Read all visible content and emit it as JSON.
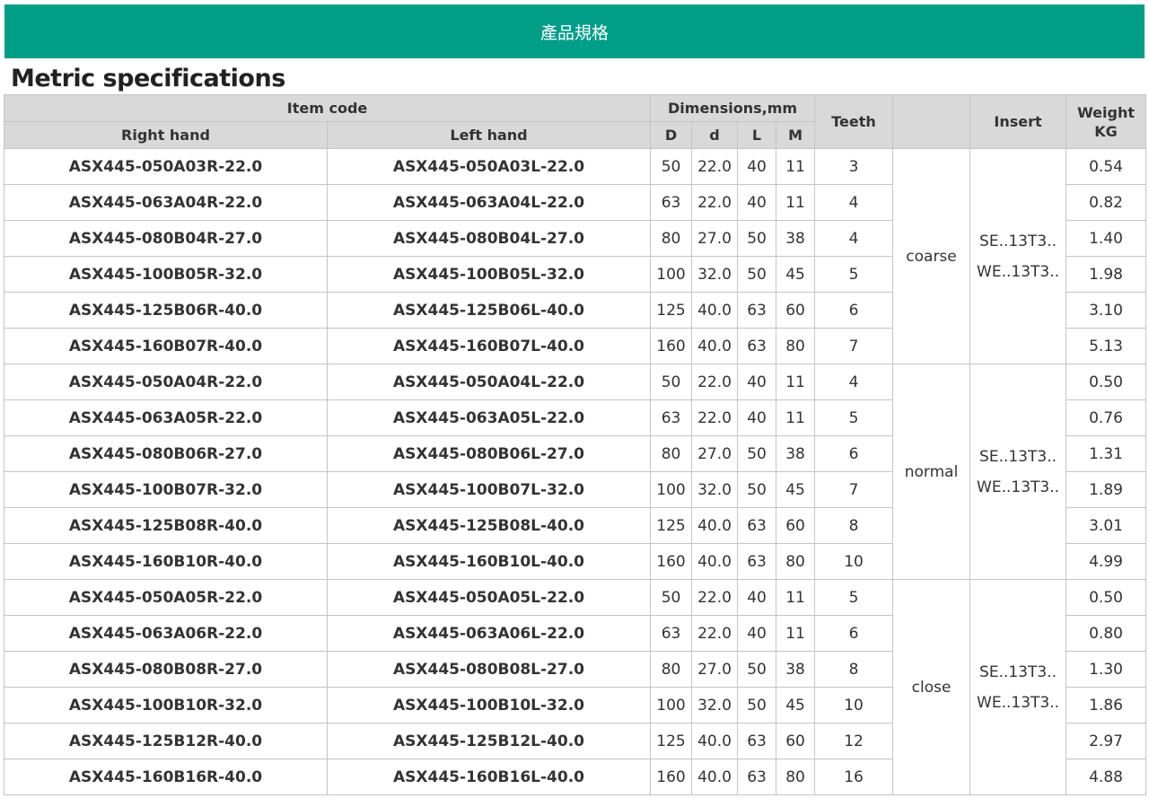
{
  "banner": {
    "label": "產品規格"
  },
  "page": {
    "title": "Metric specifications"
  },
  "table": {
    "headers": {
      "item_code": "Item code",
      "right_hand": "Right hand",
      "left_hand": "Left hand",
      "dimensions": "Dimensions,mm",
      "D": "D",
      "d": "d",
      "L": "L",
      "M": "M",
      "teeth": "Teeth",
      "pitch": "",
      "insert": "Insert",
      "weight": "Weight KG"
    },
    "groups": [
      {
        "pitch": "coarse",
        "insert": [
          "SE..13T3..",
          "WE..13T3.."
        ],
        "rows": [
          {
            "right": "ASX445-050A03R-22.0",
            "left": "ASX445-050A03L-22.0",
            "D": "50",
            "d": "22.0",
            "L": "40",
            "M": "11",
            "teeth": "3",
            "weight": "0.54"
          },
          {
            "right": "ASX445-063A04R-22.0",
            "left": "ASX445-063A04L-22.0",
            "D": "63",
            "d": "22.0",
            "L": "40",
            "M": "11",
            "teeth": "4",
            "weight": "0.82"
          },
          {
            "right": "ASX445-080B04R-27.0",
            "left": "ASX445-080B04L-27.0",
            "D": "80",
            "d": "27.0",
            "L": "50",
            "M": "38",
            "teeth": "4",
            "weight": "1.40"
          },
          {
            "right": "ASX445-100B05R-32.0",
            "left": "ASX445-100B05L-32.0",
            "D": "100",
            "d": "32.0",
            "L": "50",
            "M": "45",
            "teeth": "5",
            "weight": "1.98"
          },
          {
            "right": "ASX445-125B06R-40.0",
            "left": "ASX445-125B06L-40.0",
            "D": "125",
            "d": "40.0",
            "L": "63",
            "M": "60",
            "teeth": "6",
            "weight": "3.10"
          },
          {
            "right": "ASX445-160B07R-40.0",
            "left": "ASX445-160B07L-40.0",
            "D": "160",
            "d": "40.0",
            "L": "63",
            "M": "80",
            "teeth": "7",
            "weight": "5.13"
          }
        ]
      },
      {
        "pitch": "normal",
        "insert": [
          "SE..13T3..",
          "WE..13T3.."
        ],
        "rows": [
          {
            "right": "ASX445-050A04R-22.0",
            "left": "ASX445-050A04L-22.0",
            "D": "50",
            "d": "22.0",
            "L": "40",
            "M": "11",
            "teeth": "4",
            "weight": "0.50"
          },
          {
            "right": "ASX445-063A05R-22.0",
            "left": "ASX445-063A05L-22.0",
            "D": "63",
            "d": "22.0",
            "L": "40",
            "M": "11",
            "teeth": "5",
            "weight": "0.76"
          },
          {
            "right": "ASX445-080B06R-27.0",
            "left": "ASX445-080B06L-27.0",
            "D": "80",
            "d": "27.0",
            "L": "50",
            "M": "38",
            "teeth": "6",
            "weight": "1.31"
          },
          {
            "right": "ASX445-100B07R-32.0",
            "left": "ASX445-100B07L-32.0",
            "D": "100",
            "d": "32.0",
            "L": "50",
            "M": "45",
            "teeth": "7",
            "weight": "1.89"
          },
          {
            "right": "ASX445-125B08R-40.0",
            "left": "ASX445-125B08L-40.0",
            "D": "125",
            "d": "40.0",
            "L": "63",
            "M": "60",
            "teeth": "8",
            "weight": "3.01"
          },
          {
            "right": "ASX445-160B10R-40.0",
            "left": "ASX445-160B10L-40.0",
            "D": "160",
            "d": "40.0",
            "L": "63",
            "M": "80",
            "teeth": "10",
            "weight": "4.99"
          }
        ]
      },
      {
        "pitch": "close",
        "insert": [
          "SE..13T3..",
          "WE..13T3.."
        ],
        "rows": [
          {
            "right": "ASX445-050A05R-22.0",
            "left": "ASX445-050A05L-22.0",
            "D": "50",
            "d": "22.0",
            "L": "40",
            "M": "11",
            "teeth": "5",
            "weight": "0.50"
          },
          {
            "right": "ASX445-063A06R-22.0",
            "left": "ASX445-063A06L-22.0",
            "D": "63",
            "d": "22.0",
            "L": "40",
            "M": "11",
            "teeth": "6",
            "weight": "0.80"
          },
          {
            "right": "ASX445-080B08R-27.0",
            "left": "ASX445-080B08L-27.0",
            "D": "80",
            "d": "27.0",
            "L": "50",
            "M": "38",
            "teeth": "8",
            "weight": "1.30"
          },
          {
            "right": "ASX445-100B10R-32.0",
            "left": "ASX445-100B10L-32.0",
            "D": "100",
            "d": "32.0",
            "L": "50",
            "M": "45",
            "teeth": "10",
            "weight": "1.86"
          },
          {
            "right": "ASX445-125B12R-40.0",
            "left": "ASX445-125B12L-40.0",
            "D": "125",
            "d": "40.0",
            "L": "63",
            "M": "60",
            "teeth": "12",
            "weight": "2.97"
          },
          {
            "right": "ASX445-160B16R-40.0",
            "left": "ASX445-160B16L-40.0",
            "D": "160",
            "d": "40.0",
            "L": "63",
            "M": "80",
            "teeth": "16",
            "weight": "4.88"
          }
        ]
      }
    ]
  },
  "colors": {
    "banner_bg": "#009e87",
    "header_bg": "#d9d9d9",
    "border": "#c4c4c4"
  }
}
